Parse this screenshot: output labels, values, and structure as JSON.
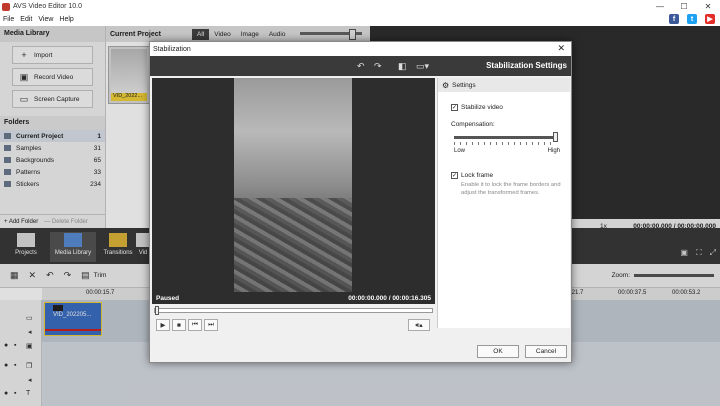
{
  "app": {
    "title": "AVS Video Editor 10.0",
    "menus": [
      "File",
      "Edit",
      "View",
      "Help"
    ],
    "window_controls": [
      "—",
      "☐",
      "✕"
    ],
    "social": [
      "f",
      "t",
      "▶"
    ]
  },
  "media_library": {
    "title": "Media Library",
    "buttons": [
      {
        "label": "Import",
        "icon": "plus-icon"
      },
      {
        "label": "Record Video",
        "icon": "record-icon"
      },
      {
        "label": "Screen Capture",
        "icon": "screen-capture-icon"
      }
    ],
    "folders_title": "Folders",
    "folders": [
      {
        "name": "Current Project",
        "count": "1"
      },
      {
        "name": "Samples",
        "count": "31"
      },
      {
        "name": "Backgrounds",
        "count": "65"
      },
      {
        "name": "Patterns",
        "count": "33"
      },
      {
        "name": "Stickers",
        "count": "234"
      }
    ],
    "add_folder": "+ Add Folder",
    "delete_folder": "— Delete Folder"
  },
  "current_project": {
    "title": "Current Project",
    "tabs": [
      "All",
      "Video",
      "Image",
      "Audio"
    ],
    "clip_label": "VID_2022..."
  },
  "preview_bar": {
    "speed": "1x",
    "time": "00:00:00.000 / 00:00:00.000"
  },
  "mid_toolbar": {
    "items": [
      "Projects",
      "Media Library",
      "Transitions",
      "Vid"
    ]
  },
  "timeline_toolbar": {
    "trim": "Trim",
    "zoom_label": "Zoom:"
  },
  "timeline": {
    "ruler": [
      "00:00:15.7",
      ":21.7",
      "00:00:37.5",
      "00:00:53.2"
    ],
    "clip_name": "VID_202205..."
  },
  "dialog": {
    "title": "Stabilization",
    "close": "✕",
    "settings_title": "Stabilization Settings",
    "status": "Paused",
    "time": "00:00:00.000 / 00:00:16.305",
    "settings_head": "Settings",
    "stabilize_label": "Stabilize video",
    "stabilize_checked": true,
    "compensation_label": "Compensation:",
    "compensation_value": 1.0,
    "low": "Low",
    "high": "High",
    "lock_label": "Lock frame",
    "lock_checked": true,
    "lock_hint": "Enable it to lock the frame borders and adjust the transformed frames.",
    "ok": "OK",
    "cancel": "Cancel"
  },
  "colors": {
    "dark": "#3a3a3a",
    "clip_blue": "#3c6fc4",
    "accent_yellow": "#f3d23a"
  }
}
